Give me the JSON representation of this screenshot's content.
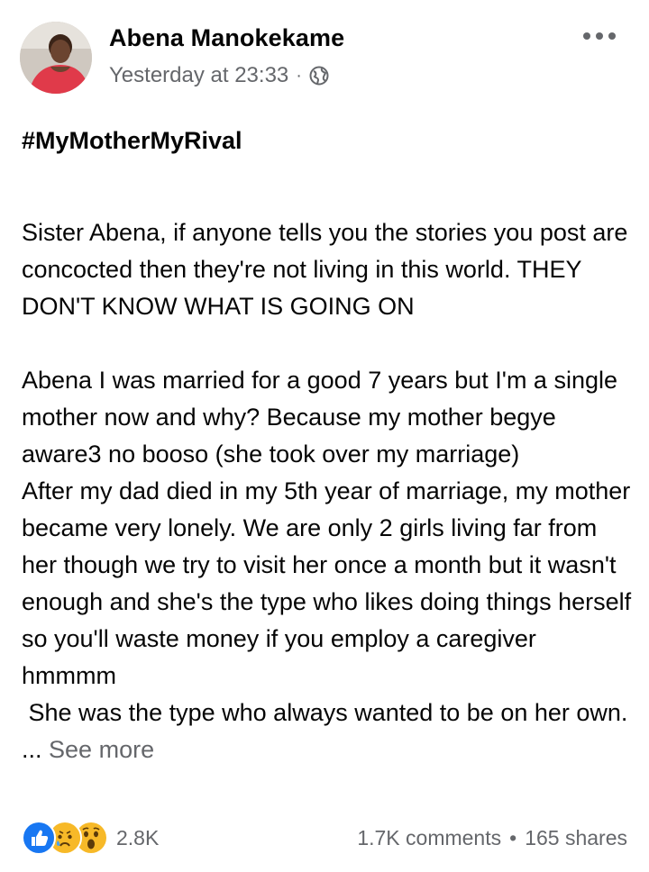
{
  "post": {
    "author": "Abena Manokekame",
    "timestamp": "Yesterday at 23:33",
    "separator": "·",
    "audience_icon": "globe-icon",
    "more_icon": "more-options-icon",
    "hashtag": "#MyMotherMyRival",
    "paragraphs": [
      "Sister Abena, if anyone tells you the stories you post are concocted then they're not living in this world. THEY DON'T  KNOW WHAT IS GOING  ON",
      "Abena I was married for a good 7 years but I'm a single mother now and why? Because my mother begye aware3 no booso (she took over my marriage)",
      "After my dad died in my 5th year of marriage, my mother became very lonely. We are only 2 girls living far from her though we try to visit her once a month but it wasn't enough and she's the type who likes doing things herself so you'll waste money if you employ a caregiver hmmmm",
      " She was the type who always wanted to be on her own. ..."
    ],
    "see_more": "See more"
  },
  "footer": {
    "reaction_icons": [
      "like-icon",
      "sad-icon",
      "wow-icon"
    ],
    "reaction_count": "2.8K",
    "comments": "1.7K comments",
    "stats_separator": "•",
    "shares": "165 shares"
  },
  "colors": {
    "text": "#050505",
    "secondary": "#65676b",
    "like_blue": "#1877f2",
    "emoji_yellow": "#f7b928"
  }
}
